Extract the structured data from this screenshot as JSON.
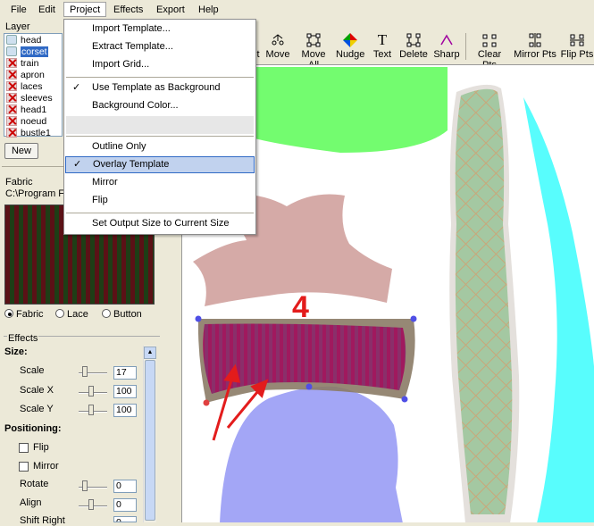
{
  "menubar": {
    "items": [
      "File",
      "Edit",
      "Project",
      "Effects",
      "Export",
      "Help"
    ]
  },
  "project_menu": {
    "items": [
      {
        "label": "Import Template...",
        "checked": false
      },
      {
        "label": "Extract Template...",
        "checked": false
      },
      {
        "label": "Import Grid...",
        "checked": false
      },
      {
        "label": "Use Template as Background",
        "checked": true
      },
      {
        "label": "Background Color...",
        "checked": false
      },
      {
        "label": "Outline Only",
        "checked": false
      },
      {
        "label": "Overlay Template",
        "checked": true,
        "highlighted": true
      },
      {
        "label": "Mirror",
        "checked": false
      },
      {
        "label": "Flip",
        "checked": false
      },
      {
        "label": "Set Output Size to Current Size",
        "checked": false
      }
    ],
    "check_glyph": "✓"
  },
  "toolbar": {
    "partial_label": "t",
    "tools": [
      {
        "label": "Move",
        "icon": "move-icon"
      },
      {
        "label": "Move All",
        "icon": "move-all-icon"
      },
      {
        "label": "Nudge",
        "icon": "nudge-icon"
      },
      {
        "label": "Text",
        "icon": "text-icon"
      },
      {
        "label": "Delete",
        "icon": "delete-icon"
      },
      {
        "label": "Sharp",
        "icon": "sharp-icon"
      },
      {
        "label": "Clear Pts",
        "icon": "clear-points-icon"
      },
      {
        "label": "Mirror Pts",
        "icon": "mirror-points-icon"
      },
      {
        "label": "Flip Pts",
        "icon": "flip-points-icon"
      }
    ],
    "text_glyph": "T"
  },
  "layers": {
    "title": "Layer",
    "items": [
      {
        "name": "head",
        "visible": true
      },
      {
        "name": "corset",
        "visible": true,
        "selected": true
      },
      {
        "name": "train",
        "visible": false
      },
      {
        "name": "apron",
        "visible": false
      },
      {
        "name": "laces",
        "visible": false
      },
      {
        "name": "sleeves",
        "visible": false
      },
      {
        "name": "head1",
        "visible": false
      },
      {
        "name": "noeud",
        "visible": false
      },
      {
        "name": "bustle1",
        "visible": false
      }
    ],
    "new_button": "New"
  },
  "fabric": {
    "title": "Fabric",
    "path": "C:\\Program  F",
    "options": [
      "Fabric",
      "Lace",
      "Button"
    ],
    "selected": "Fabric"
  },
  "effects": {
    "title": "Effects",
    "size_heading": "Size:",
    "scale_label": "Scale",
    "scale_value": "17",
    "scale_x_label": "Scale X",
    "scale_x_value": "100",
    "scale_y_label": "Scale Y",
    "scale_y_value": "100",
    "positioning_heading": "Positioning:",
    "flip_label": "Flip",
    "mirror_label": "Mirror",
    "rotate_label": "Rotate",
    "rotate_value": "0",
    "align_label": "Align",
    "align_value": "0",
    "shift_right_label": "Shift Right",
    "shift_right_value": "0"
  },
  "canvas": {
    "annotation_number": "4",
    "colors": {
      "green_piece": "#73fc6f",
      "pink_piece": "#d5aaa7",
      "corset": "#a0195e",
      "blue_piece": "#a3a6f6",
      "cyan_piece": "#58fdfd",
      "lace_piece": "#a4c8a2",
      "arrow": "#e31c1c",
      "points": "#4f4fe6"
    }
  }
}
